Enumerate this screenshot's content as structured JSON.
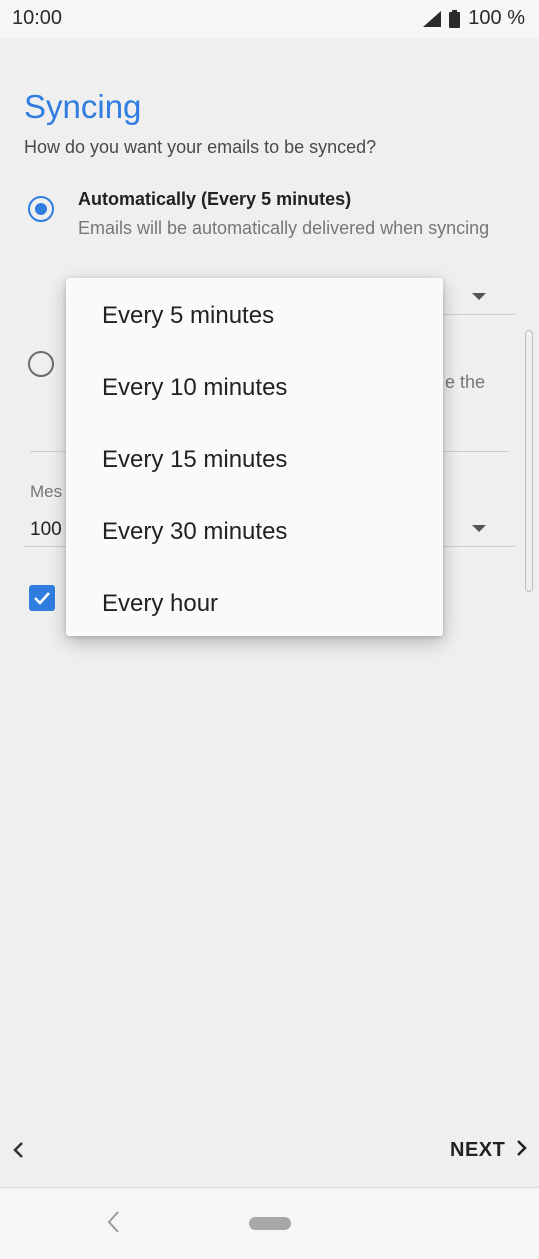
{
  "status_bar": {
    "time": "10:00",
    "battery": "100 %"
  },
  "page": {
    "title": "Syncing",
    "subtitle": "How do you want your emails to be synced?"
  },
  "options": {
    "automatic": {
      "title": "Automatically (Every 5 minutes)",
      "description": "Emails will be automatically delivered when syncing",
      "selected": true
    },
    "manual": {
      "visible_fragment": "e the",
      "selected": false
    }
  },
  "messages": {
    "label_fragment": "Mes",
    "value_fragment": "100"
  },
  "checkbox": {
    "checked": true
  },
  "dropdown_menu": {
    "items": [
      "Every 5 minutes",
      "Every 10 minutes",
      "Every 15 minutes",
      "Every 30 minutes",
      "Every hour"
    ]
  },
  "footer": {
    "next_label": "NEXT"
  },
  "colors": {
    "accent": "#2f7de1"
  }
}
